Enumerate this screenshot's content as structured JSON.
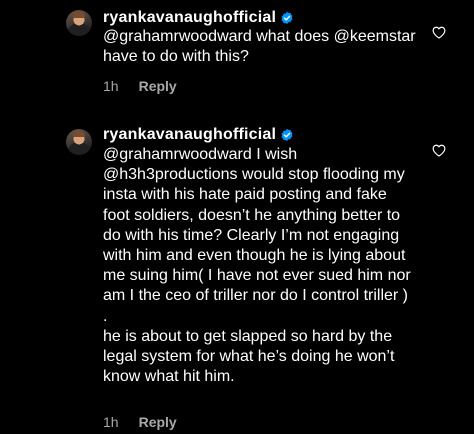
{
  "comments": [
    {
      "username": "ryankavanaughofficial",
      "text": "@grahamrwoodward what does @keemstar have to do with this?",
      "time": "1h",
      "reply_label": "Reply"
    },
    {
      "username": "ryankavanaughofficial",
      "text": "@grahamrwoodward I wish @h3h3productions would stop flooding my insta with his hate paid posting and fake foot soldiers, doesn’t he anything better to do with his time? Clearly I’m not engaging with him and even though he is lying about me suing him( I have not ever sued him nor am I the ceo of triller nor do I control triller ) .\nhe is about to get slapped so hard by the legal system for what he’s doing he won’t know what hit him.",
      "time": "1h",
      "reply_label": "Reply"
    }
  ],
  "colors": {
    "background": "#000000",
    "text": "#ffffff",
    "muted": "#a8a8a8",
    "verified": "#0095f6"
  },
  "icons": {
    "verified": "verified-badge-icon",
    "like": "heart-outline-icon"
  }
}
